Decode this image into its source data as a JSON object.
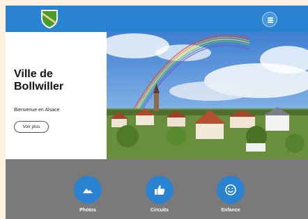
{
  "header": {
    "logo_icon": "bollwiller-coat-of-arms-icon",
    "menu_icon": "hamburger-menu-icon",
    "color": "#2a83d1"
  },
  "hero": {
    "title": "Ville de Bollwiller",
    "subtitle": "Bienvenue en Alsace",
    "cta_label": "Voir plus",
    "image_alt": "rainbow over village"
  },
  "shortcuts": [
    {
      "label": "Photos",
      "icon": "mountain-photo-icon"
    },
    {
      "label": "Circuits",
      "icon": "thumbs-up-icon"
    },
    {
      "label": "Enfance",
      "icon": "smiley-face-icon"
    }
  ]
}
